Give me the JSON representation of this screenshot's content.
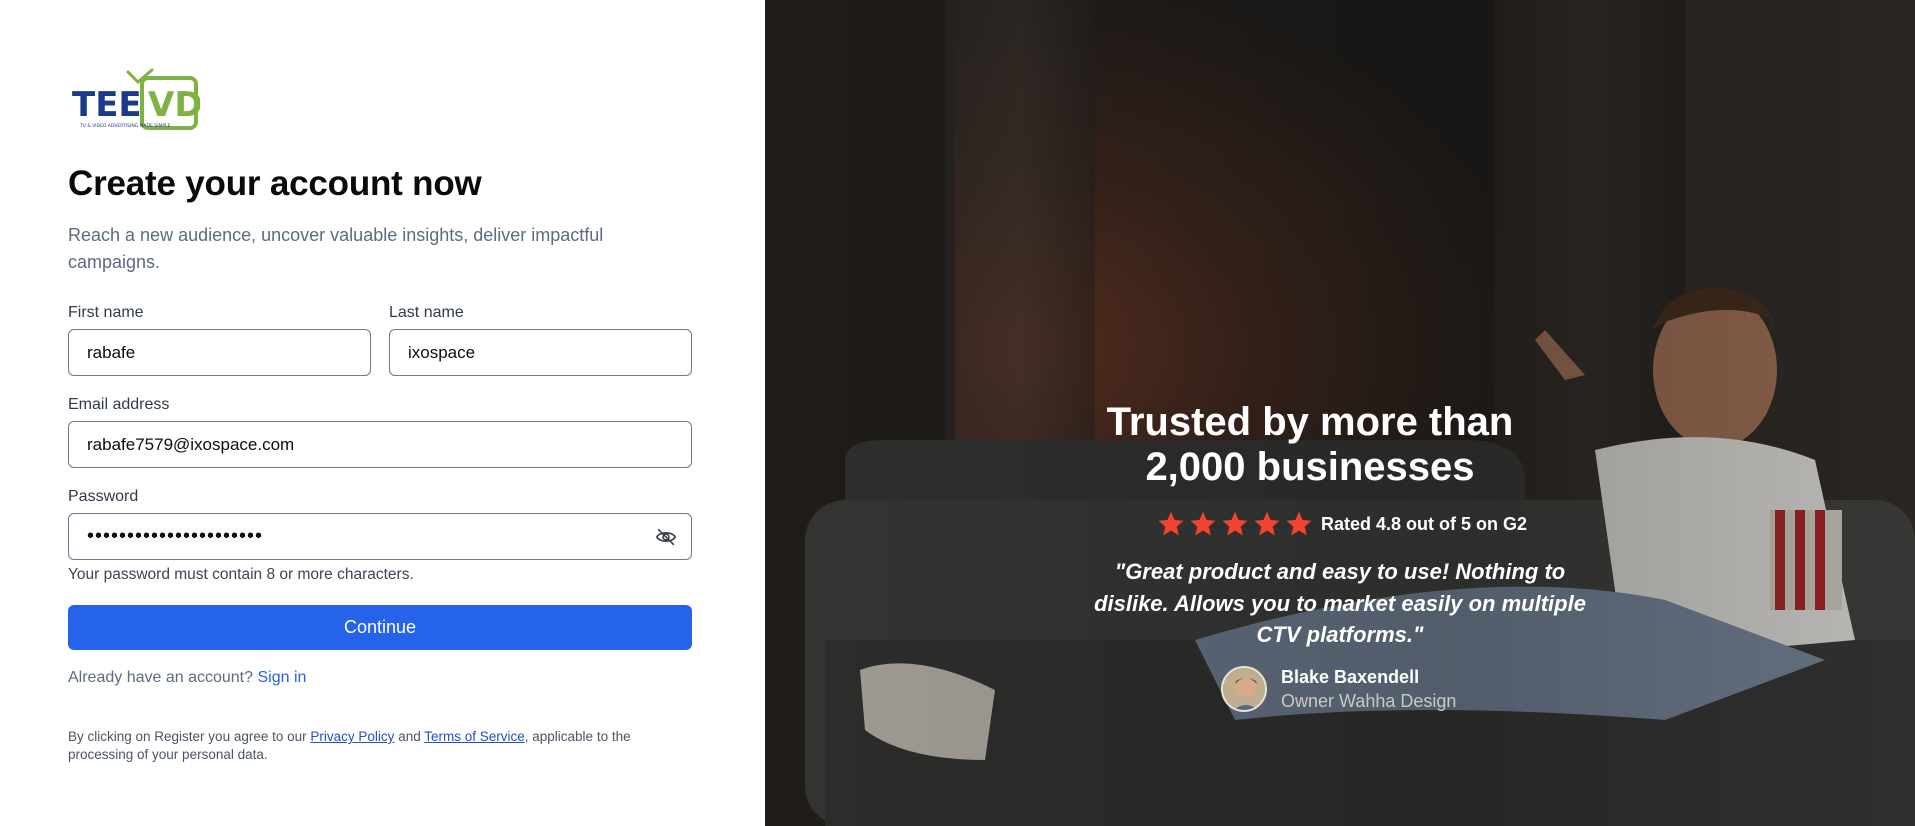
{
  "brand": {
    "logo_text": "TEEVD",
    "logo_tagline": "TV & VIDEO ADVERTISING MADE SIMPLE"
  },
  "form": {
    "title": "Create your account now",
    "subtitle": "Reach a new audience, uncover valuable insights, deliver impactful campaigns.",
    "first_name": {
      "label": "First name",
      "value": "rabafe"
    },
    "last_name": {
      "label": "Last name",
      "value": "ixospace"
    },
    "email": {
      "label": "Email address",
      "value": "rabafe7579@ixospace.com"
    },
    "password": {
      "label": "Password",
      "value": "••••••••••••••••••••••",
      "hint": "Your password must contain 8 or more characters."
    },
    "continue_label": "Continue",
    "signin_prompt": "Already have an account?",
    "signin_link": "Sign in",
    "legal_prefix": "By clicking on Register you agree to our",
    "privacy_link": "Privacy Policy",
    "legal_and": "and",
    "terms_link": "Terms of Service",
    "legal_suffix": ", applicable to the processing of your personal data."
  },
  "testimonial": {
    "headline_line1": "Trusted by more than",
    "headline_line2": "2,000 businesses",
    "stars": 5,
    "rating_text": "Rated 4.8 out of 5 on G2",
    "quote": "\"Great product and easy to use! Nothing to dislike. Allows you to market easily on multiple CTV platforms.\"",
    "author_name": "Blake Baxendell",
    "author_role": "Owner Wahha Design"
  },
  "colors": {
    "primary": "#2563eb",
    "star": "#f0442f",
    "logo_blue": "#1b3a8c",
    "logo_green": "#7cb342"
  }
}
